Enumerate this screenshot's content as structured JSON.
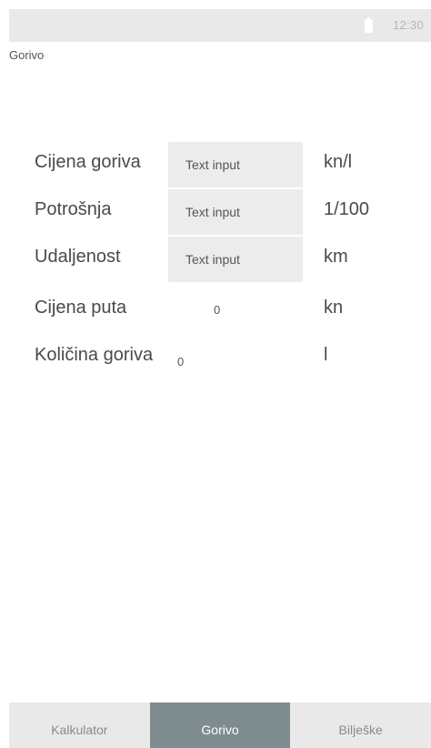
{
  "status_bar": {
    "time": "12:30"
  },
  "app": {
    "title": "Gorivo"
  },
  "form": {
    "rows": [
      {
        "label": "Cijena goriva",
        "input_placeholder": "Text input",
        "unit": "kn/l"
      },
      {
        "label": "Potrošnja",
        "input_placeholder": "Text input",
        "unit": "1/100"
      },
      {
        "label": "Udaljenost",
        "input_placeholder": "Text input",
        "unit": "km"
      },
      {
        "label": "Cijena puta",
        "value": "0",
        "unit": "kn"
      },
      {
        "label": "Količina goriva",
        "value": "0",
        "unit": "l"
      }
    ]
  },
  "tabs": [
    {
      "label": "Kalkulator",
      "active": false
    },
    {
      "label": "Gorivo",
      "active": true
    },
    {
      "label": "Bilješke",
      "active": false
    }
  ],
  "colors": {
    "status_bar": "#e9e9e9",
    "input_background": "#ececec",
    "active_tab": "#7e8c90",
    "inactive_tab": "#e9e9e9"
  },
  "icons": {
    "status": "battery-icon"
  }
}
